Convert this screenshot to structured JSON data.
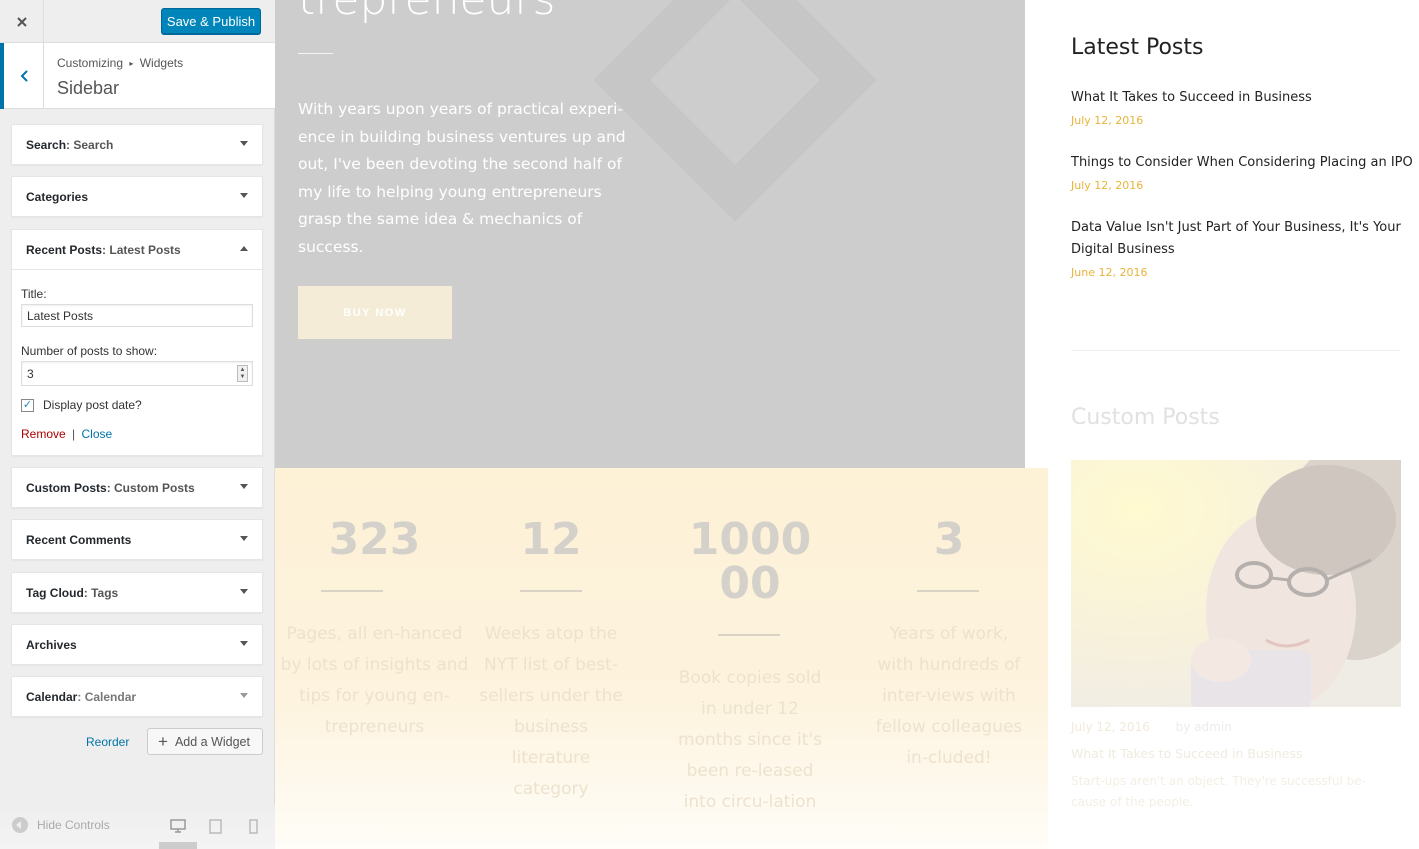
{
  "customizer": {
    "publish_label": "Save & Publish",
    "breadcrumb": {
      "root": "Customizing",
      "separator": "▸",
      "current": "Widgets"
    },
    "section_title": "Sidebar",
    "widgets": [
      {
        "name": "Search",
        "sub": ": Search"
      },
      {
        "name": "Categories",
        "sub": ""
      },
      {
        "name": "Recent Posts",
        "sub": ": Latest Posts"
      },
      {
        "name": "Custom Posts",
        "sub": ": Custom Posts"
      },
      {
        "name": "Recent Comments",
        "sub": ""
      },
      {
        "name": "Tag Cloud",
        "sub": ": Tags"
      },
      {
        "name": "Archives",
        "sub": ""
      },
      {
        "name": "Calendar",
        "sub": ": Calendar"
      }
    ],
    "recent_posts_form": {
      "title_label": "Title:",
      "title_value": "Latest Posts",
      "number_label": "Number of posts to show:",
      "number_value": "3",
      "checkbox_label": "Display post date?",
      "checkbox_checked": true,
      "remove_label": "Remove",
      "separator": "|",
      "close_label": "Close"
    },
    "reorder_label": "Reorder",
    "add_widget_label": "Add a Widget",
    "hide_controls_label": "Hide Controls",
    "accent_color": "#0085ba"
  },
  "preview": {
    "hero": {
      "title": "trepreneurs",
      "text": "With years upon years of practical experi-ence in building business ventures up and out, I've been devoting the second half of my life to helping young entrepreneurs grasp the same idea & mechanics of success.",
      "button_label": "BUY NOW"
    },
    "stats": [
      {
        "number": "323",
        "desc": "Pages, all en-hanced by lots of insights and tips for young en-trepreneurs"
      },
      {
        "number": "12",
        "desc": "Weeks atop the NYT list of best-sellers under the business literature category"
      },
      {
        "number": "100000",
        "desc": "Book copies sold in under 12 months since it's been re-leased into circu-lation"
      },
      {
        "number": "3",
        "desc": "Years of work, with hundreds of inter-views with fellow colleagues in-cluded!"
      }
    ],
    "latest_posts": {
      "heading": "Latest Posts",
      "items": [
        {
          "title": "What It Takes to Succeed in Business",
          "date": "July 12, 2016"
        },
        {
          "title": "Things to Consider When Considering Placing an IPO",
          "date": "July 12, 2016"
        },
        {
          "title": "Data Value Isn't Just Part of Your Business, It's Your Digital Business",
          "date": "June 12, 2016"
        }
      ]
    },
    "custom_posts": {
      "heading": "Custom Posts",
      "date": "July 12, 2016",
      "by": "by admin",
      "title": "What It Takes to Succeed in Business",
      "excerpt": "Start-ups aren't an object. They're successful be-cause of the people."
    }
  }
}
